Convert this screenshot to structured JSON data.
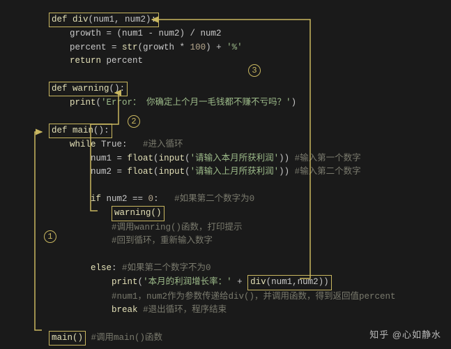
{
  "lines": [
    {
      "indent": 1,
      "box": true,
      "segs": [
        {
          "t": "def ",
          "c": "kw"
        },
        {
          "t": "div",
          "c": "fn"
        },
        {
          "t": "(num1, num2)",
          "c": "id"
        },
        {
          "t": ":",
          "c": "op"
        }
      ]
    },
    {
      "indent": 2,
      "segs": [
        {
          "t": "growth = (num1 - num2) / num2",
          "c": "id"
        }
      ]
    },
    {
      "indent": 2,
      "segs": [
        {
          "t": "percent = ",
          "c": "id"
        },
        {
          "t": "str",
          "c": "fn"
        },
        {
          "t": "(growth * ",
          "c": "id"
        },
        {
          "t": "100",
          "c": "num"
        },
        {
          "t": ") + ",
          "c": "id"
        },
        {
          "t": "'%'",
          "c": "str"
        }
      ]
    },
    {
      "indent": 2,
      "segs": [
        {
          "t": "return",
          "c": "kw"
        },
        {
          "t": " percent",
          "c": "id"
        }
      ]
    },
    {
      "indent": 0,
      "segs": [
        {
          "t": " ",
          "c": "id"
        }
      ]
    },
    {
      "indent": 1,
      "box": true,
      "segs": [
        {
          "t": "def ",
          "c": "kw"
        },
        {
          "t": "warning",
          "c": "fn"
        },
        {
          "t": "()",
          "c": "id"
        },
        {
          "t": ":",
          "c": "op"
        }
      ]
    },
    {
      "indent": 2,
      "segs": [
        {
          "t": "print",
          "c": "fn"
        },
        {
          "t": "(",
          "c": "id"
        },
        {
          "t": "'Error： 你确定上个月一毛钱都不赚不亏吗？'",
          "c": "str"
        },
        {
          "t": ")",
          "c": "id"
        }
      ]
    },
    {
      "indent": 0,
      "segs": [
        {
          "t": " ",
          "c": "id"
        }
      ]
    },
    {
      "indent": 1,
      "box": true,
      "segs": [
        {
          "t": "def ",
          "c": "kw"
        },
        {
          "t": "main",
          "c": "fn"
        },
        {
          "t": "()",
          "c": "id"
        },
        {
          "t": ":",
          "c": "op"
        }
      ]
    },
    {
      "indent": 2,
      "segs": [
        {
          "t": "while",
          "c": "kw"
        },
        {
          "t": " True:   ",
          "c": "id"
        },
        {
          "t": "#进入循环",
          "c": "cmt"
        }
      ]
    },
    {
      "indent": 3,
      "segs": [
        {
          "t": "num1 = ",
          "c": "id"
        },
        {
          "t": "float",
          "c": "fn"
        },
        {
          "t": "(",
          "c": "id"
        },
        {
          "t": "input",
          "c": "fn"
        },
        {
          "t": "(",
          "c": "id"
        },
        {
          "t": "'请输入本月所获利润'",
          "c": "str"
        },
        {
          "t": ")) ",
          "c": "id"
        },
        {
          "t": "#输入第一个数字",
          "c": "cmt"
        }
      ]
    },
    {
      "indent": 3,
      "segs": [
        {
          "t": "num2 = ",
          "c": "id"
        },
        {
          "t": "float",
          "c": "fn"
        },
        {
          "t": "(",
          "c": "id"
        },
        {
          "t": "input",
          "c": "fn"
        },
        {
          "t": "(",
          "c": "id"
        },
        {
          "t": "'请输入上月所获利润'",
          "c": "str"
        },
        {
          "t": ")) ",
          "c": "id"
        },
        {
          "t": "#输入第二个数字",
          "c": "cmt"
        }
      ]
    },
    {
      "indent": 0,
      "segs": [
        {
          "t": " ",
          "c": "id"
        }
      ]
    },
    {
      "indent": 3,
      "segs": [
        {
          "t": "if",
          "c": "kw"
        },
        {
          "t": " num2 == ",
          "c": "id"
        },
        {
          "t": "0",
          "c": "num"
        },
        {
          "t": ":   ",
          "c": "id"
        },
        {
          "t": "#如果第二个数字为0",
          "c": "cmt"
        }
      ]
    },
    {
      "indent": 4,
      "box": true,
      "segs": [
        {
          "t": "warning()",
          "c": "fn"
        }
      ]
    },
    {
      "indent": 4,
      "segs": [
        {
          "t": "#调用wanring()函数，打印提示",
          "c": "cmt"
        }
      ]
    },
    {
      "indent": 4,
      "segs": [
        {
          "t": "#回到循环，重新输入数字",
          "c": "cmt"
        }
      ]
    },
    {
      "indent": 0,
      "segs": [
        {
          "t": " ",
          "c": "id"
        }
      ]
    },
    {
      "indent": 3,
      "segs": [
        {
          "t": "else",
          "c": "kw"
        },
        {
          "t": ": ",
          "c": "id"
        },
        {
          "t": "#如果第二个数字不为0",
          "c": "cmt"
        }
      ]
    },
    {
      "indent": 4,
      "segs": [
        {
          "t": "print",
          "c": "fn"
        },
        {
          "t": "(",
          "c": "id"
        },
        {
          "t": "'本月的利润增长率：'",
          "c": "str"
        },
        {
          "t": " + ",
          "c": "id"
        }
      ],
      "tail_box": [
        {
          "t": "div",
          "c": "fn"
        },
        {
          "t": "(num1,num2))",
          "c": "id"
        }
      ]
    },
    {
      "indent": 4,
      "segs": [
        {
          "t": "#num1，num2作为参数传递给div()，并调用函数，得到返回值percent",
          "c": "cmt"
        }
      ]
    },
    {
      "indent": 4,
      "segs": [
        {
          "t": "break",
          "c": "kw"
        },
        {
          "t": " ",
          "c": "id"
        },
        {
          "t": "#退出循环，程序结束",
          "c": "cmt"
        }
      ]
    },
    {
      "indent": 0,
      "segs": [
        {
          "t": " ",
          "c": "id"
        }
      ]
    },
    {
      "indent": 1,
      "box": true,
      "segs": [
        {
          "t": "main()",
          "c": "fn"
        }
      ],
      "tail": [
        {
          "t": " #调用main()函数",
          "c": "cmt"
        }
      ]
    }
  ],
  "annotations": {
    "one": "1",
    "two": "2",
    "three": "3"
  },
  "watermark": "知乎 @心如静水"
}
